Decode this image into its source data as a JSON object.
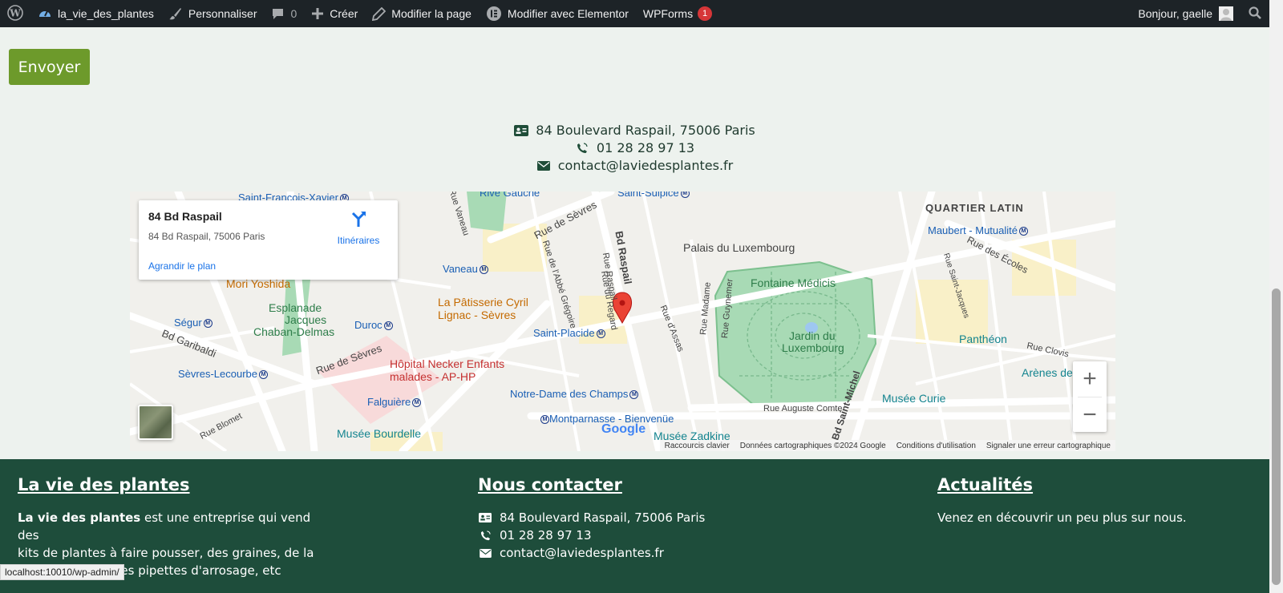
{
  "adminbar": {
    "site_name": "la_vie_des_plantes",
    "customize": "Personnaliser",
    "comments_count": "0",
    "create": "Créer",
    "edit_page": "Modifier la page",
    "elementor": "Modifier avec Elementor",
    "wpforms": "WPForms",
    "wpforms_badge": "1",
    "greeting": "Bonjour, gaelle"
  },
  "form": {
    "submit_label": "Envoyer"
  },
  "contact": {
    "address": "84 Boulevard Raspail, 75006 Paris",
    "phone": "01 28 28 97 13",
    "email": "contact@laviedesplantes.fr"
  },
  "map": {
    "info_title": "84 Bd Raspail",
    "info_address": "84 Bd Raspail, 75006 Paris",
    "info_link": "Agrandir le plan",
    "directions": "Itinéraires",
    "labels": {
      "saint_francois": "Saint-François-Xavier",
      "rive_gauche": "Rive Gauche",
      "saint_sulpice": "Saint-Sulpice",
      "quartier_latin": "QUARTIER LATIN",
      "maubert": "Maubert - Mutualité",
      "rue_ecoles": "Rue des Écoles",
      "palais": "Palais du Luxembourg",
      "fontaine": "Fontaine Médicis",
      "jardin_1": "Jardin du",
      "jardin_2": "Luxembourg",
      "pantheon": "Panthéon",
      "arenes": "Arènes de",
      "musee_curie": "Musée Curie",
      "mori": "Mori Yoshida",
      "esplanade_1": "Esplanade",
      "esplanade_2": "Jacques",
      "esplanade_3": "Chaban-Delmas",
      "vaneau": "Vaneau",
      "patisserie_1": "La Pâtisserie Cyril",
      "patisserie_2": "Lignac - Sèvres",
      "segur": "Ségur",
      "duroc": "Duroc",
      "saint_placide": "Saint-Placide",
      "bd_garibaldi": "Bd Garibaldi",
      "rue_sevres_1": "Rue de Sèvres",
      "rue_sevres_2": "Rue de Sèvres",
      "hopital_1": "Hôpital Necker Enfants",
      "hopital_2": "malades - AP-HP",
      "sevres_lecourbe": "Sèvres-Lecourbe",
      "falguiere": "Falguière",
      "notre_dame": "Notre-Dame des Champs",
      "montparnasse": "Montparnasse - Bienvenüe",
      "bourdelle": "Musée Bourdelle",
      "zadkine": "Musée Zadkine",
      "bd_raspail": "Bd Raspail",
      "rue_raspail": "Rue Raspail",
      "rue_regard": "Rue du Regard",
      "rue_abbe": "Rue de l'Abbé Grégoire",
      "rue_vaneau": "Rue Vaneau",
      "rue_assas": "Rue d'Assas",
      "rue_madame": "Rue Madame",
      "rue_guynemer": "Rue Guynemer",
      "rue_auguste_comte": "Rue Auguste Comte",
      "rue_clovis": "Rue Clovis",
      "bd_saint_michel": "Bd Saint-Michel",
      "rue_saint_jacques": "Rue Saint-Jacques",
      "rue_blomet": "Rue Blomet",
      "google": "Google"
    },
    "attrib": {
      "shortcuts": "Raccourcis clavier",
      "data": "Données cartographiques ©2024 Google",
      "terms": "Conditions d'utilisation",
      "report": "Signaler une erreur cartographique"
    },
    "zoom_in": "+",
    "zoom_out": "−"
  },
  "footer": {
    "col1_title": "La vie des plantes",
    "col1_bold": "La vie des plantes",
    "col1_text_1": " est une entreprise qui vend des",
    "col1_text_2": "kits de plantes à faire pousser, des graines, de la",
    "col1_text_3": "terre, des pots, des pipettes d'arrosage, etc",
    "col2_title": "Nous contacter",
    "col2_address": "84 Boulevard Raspail, 75006 Paris",
    "col2_phone": "01 28 28 97 13",
    "col2_email": "contact@laviedesplantes.fr",
    "col3_title": "Actualités",
    "col3_text": "Venez en découvrir un peu plus sur nous."
  },
  "statusbar": {
    "url": "localhost:10010/wp-admin/"
  },
  "colors": {
    "adminbar": "#1d2327",
    "button": "#6d9a2b",
    "footer": "#1e4d3b",
    "page_bg": "#edf2ee"
  }
}
